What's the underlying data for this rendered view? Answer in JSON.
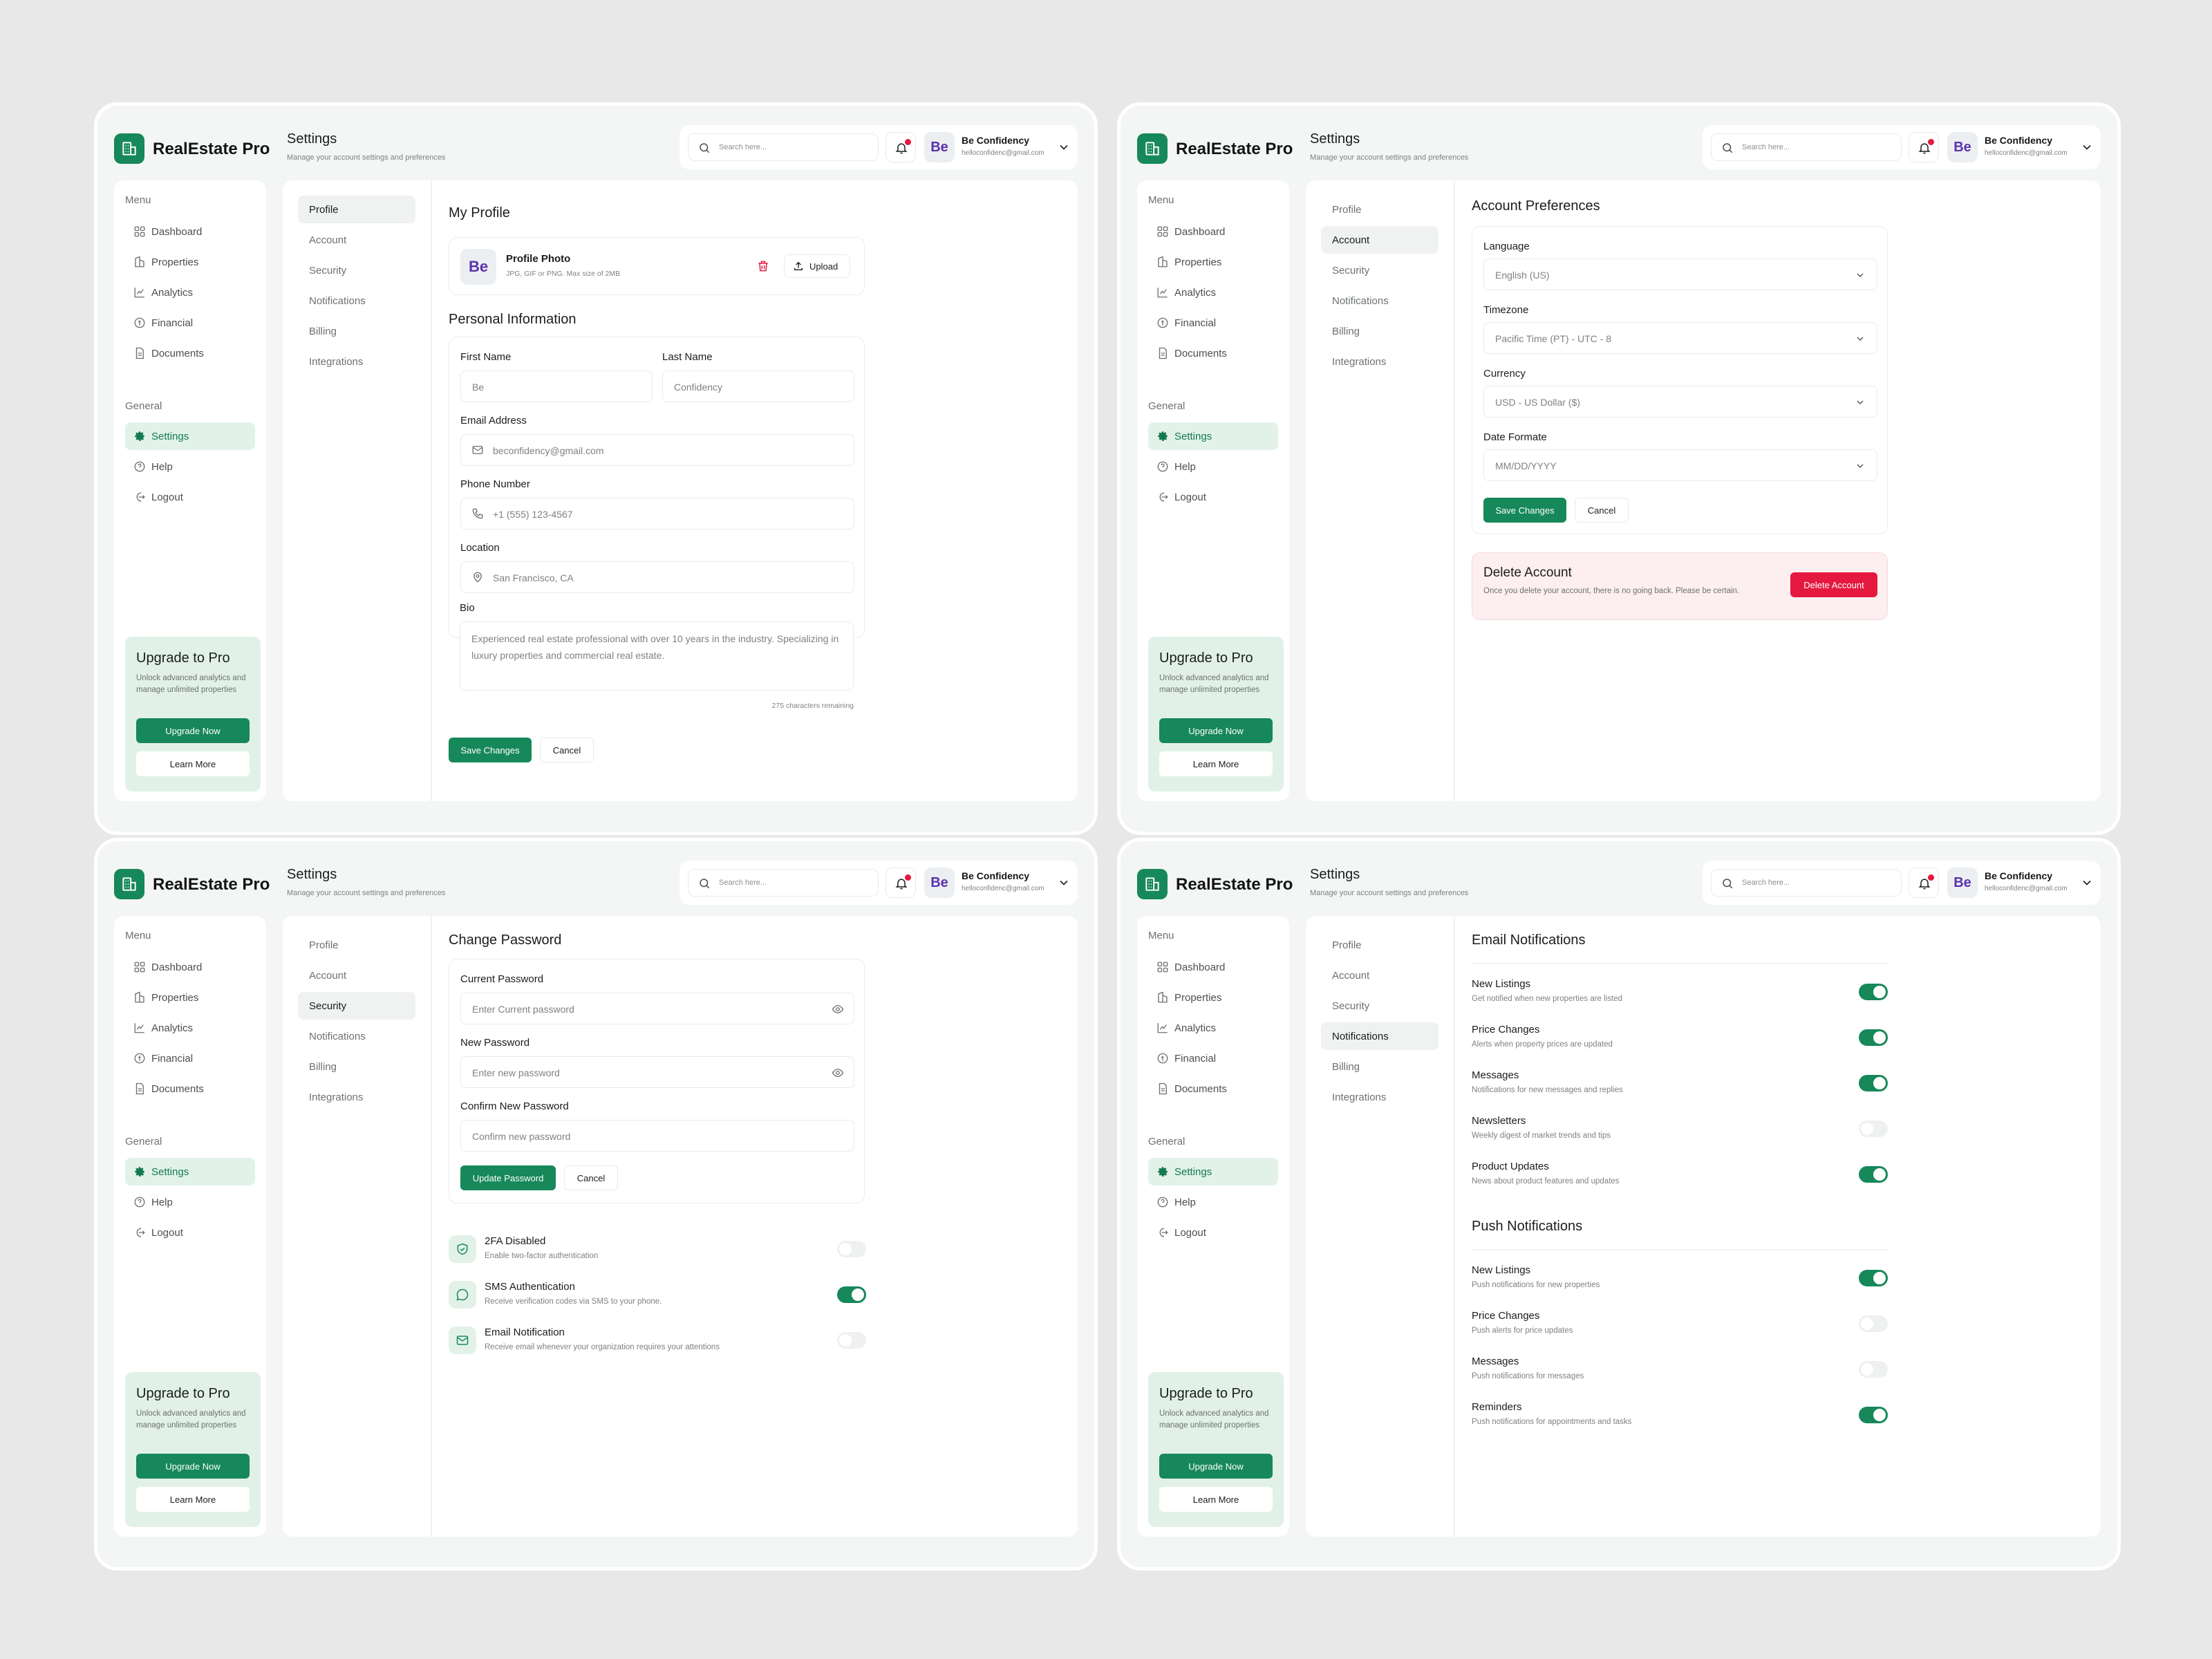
{
  "app": {
    "brand": "RealEstate Pro",
    "page_title": "Settings",
    "page_subtitle": "Manage your account settings and preferences",
    "search_placeholder": "Search here...",
    "user_name": "Be Confidency",
    "user_email": "helloconfidenc@gmail.com",
    "avatar_initials": "Be"
  },
  "sidebar": {
    "menu_label": "Menu",
    "menu_items": [
      {
        "label": "Dashboard",
        "icon": "dashboard-icon"
      },
      {
        "label": "Properties",
        "icon": "building-icon"
      },
      {
        "label": "Analytics",
        "icon": "chart-icon"
      },
      {
        "label": "Financial",
        "icon": "coin-icon"
      },
      {
        "label": "Documents",
        "icon": "document-icon"
      }
    ],
    "general_label": "General",
    "general_items": [
      {
        "label": "Settings",
        "icon": "gear-icon"
      },
      {
        "label": "Help",
        "icon": "help-icon"
      },
      {
        "label": "Logout",
        "icon": "logout-icon"
      }
    ],
    "upgrade": {
      "title": "Upgrade to Pro",
      "desc": "Unlock advanced analytics and manage unlimited properties",
      "primary": "Upgrade Now",
      "secondary": "Learn More"
    }
  },
  "subnav": [
    "Profile",
    "Account",
    "Security",
    "Notifications",
    "Billing",
    "Integrations"
  ],
  "profile": {
    "title": "My Profile",
    "photo_title": "Profile Photo",
    "photo_hint": "JPG, GIF or PNG. Max size of 2MB",
    "upload": "Upload",
    "personal_title": "Personal Information",
    "first_name_label": "First Name",
    "first_name": "Be",
    "last_name_label": "Last Name",
    "last_name": "Confidency",
    "email_label": "Email Address",
    "email": "beconfidency@gmail.com",
    "phone_label": "Phone Number",
    "phone": "+1 (555) 123-4567",
    "location_label": "Location",
    "location": "San Francisco, CA",
    "bio_label": "Bio",
    "bio": "Experienced real estate professional with over 10 years in the industry. Specializing in luxury properties and commercial real estate.",
    "chars_remaining": "275 characters remaining",
    "save": "Save Changes",
    "cancel": "Cancel"
  },
  "account": {
    "title": "Account Preferences",
    "language_label": "Language",
    "language": "English (US)",
    "timezone_label": "Timezone",
    "timezone": "Pacific Time (PT) - UTC - 8",
    "currency_label": "Currency",
    "currency": "USD - US Dollar ($)",
    "date_label": "Date Formate",
    "date_format": "MM/DD/YYYY",
    "save": "Save Changes",
    "cancel": "Cancel",
    "delete_title": "Delete Account",
    "delete_desc": "Once you delete your account, there is no going back. Please be certain.",
    "delete_button": "Delete Account",
    "danger_color": "#e5183f"
  },
  "security": {
    "title": "Change Password",
    "current_label": "Current Password",
    "current_placeholder": "Enter Current password",
    "new_label": "New Password",
    "new_placeholder": "Enter new password",
    "confirm_label": "Confirm New Password",
    "confirm_placeholder": "Confirm new password",
    "update": "Update Password",
    "cancel": "Cancel",
    "options": [
      {
        "title": "2FA Disabled",
        "desc": "Enable two-factor authentication",
        "on": false,
        "icon": "shield-check-icon"
      },
      {
        "title": "SMS Authentication",
        "desc": "Receive verification codes via SMS to your phone.",
        "on": true,
        "icon": "chat-icon"
      },
      {
        "title": "Email Notification",
        "desc": "Receive email whenever your organization requires your attentions",
        "on": false,
        "icon": "mail-icon"
      }
    ]
  },
  "notifications": {
    "email_title": "Email Notifications",
    "email_items": [
      {
        "title": "New Listings",
        "desc": "Get notified when new properties are listed",
        "on": true
      },
      {
        "title": "Price Changes",
        "desc": "Alerts when property prices are updated",
        "on": true
      },
      {
        "title": "Messages",
        "desc": "Notifications for new messages and replies",
        "on": true
      },
      {
        "title": "Newsletters",
        "desc": "Weekly digest of market trends and tips",
        "on": false
      },
      {
        "title": "Product Updates",
        "desc": "News about product features and updates",
        "on": true
      }
    ],
    "push_title": "Push Notifications",
    "push_items": [
      {
        "title": "New Listings",
        "desc": "Push notifications for new properties",
        "on": true
      },
      {
        "title": "Price Changes",
        "desc": "Push alerts for price updates",
        "on": false
      },
      {
        "title": "Messages",
        "desc": "Push notifications for messages",
        "on": false
      },
      {
        "title": "Reminders",
        "desc": "Push notifications for appointments and tasks",
        "on": true
      }
    ]
  },
  "colors": {
    "accent": "#16885a",
    "accent_light": "#e2f2e9",
    "background": "#e7e8e7"
  }
}
